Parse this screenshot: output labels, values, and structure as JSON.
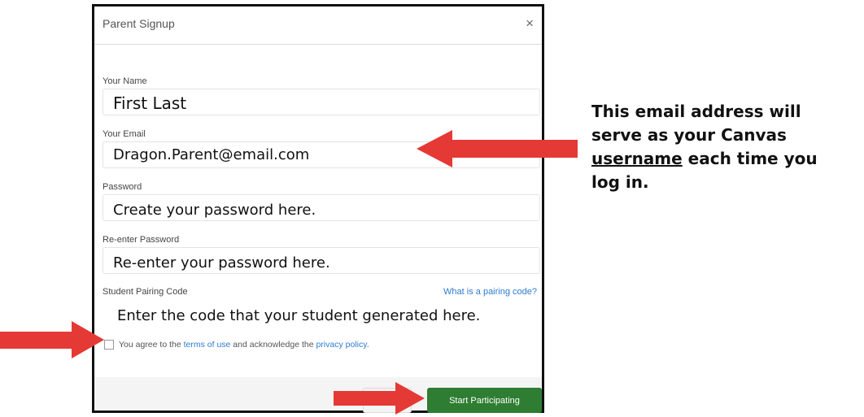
{
  "dialog": {
    "title": "Parent Signup",
    "close": "×",
    "fields": {
      "name": {
        "label": "Your Name",
        "value": "First Last"
      },
      "email": {
        "label": "Your Email",
        "value": "Dragon.Parent@email.com"
      },
      "password": {
        "label": "Password",
        "value": "Create your password here."
      },
      "reenter": {
        "label": "Re-enter Password",
        "value": "Re-enter your password here."
      },
      "pairing": {
        "label": "Student Pairing Code",
        "link": "What is a pairing code?",
        "value": "Enter the code that your student generated here."
      }
    },
    "agreement": {
      "prefix": "You agree to the ",
      "terms_link": "terms of use",
      "middle": " and acknowledge the ",
      "privacy_link": "privacy policy",
      "suffix": "."
    },
    "start_button": "Start Participating"
  },
  "annotation": {
    "line1": "This email address will",
    "line2": "serve as your Canvas",
    "underlined": "username",
    "line3_rest": " each time you",
    "line4": "log in."
  },
  "colors": {
    "arrow": "#e53935",
    "button": "#2e7d32",
    "link": "#2d7bd1"
  },
  "icons": {
    "arrows": "red-pointer-arrow",
    "close": "close-icon"
  }
}
